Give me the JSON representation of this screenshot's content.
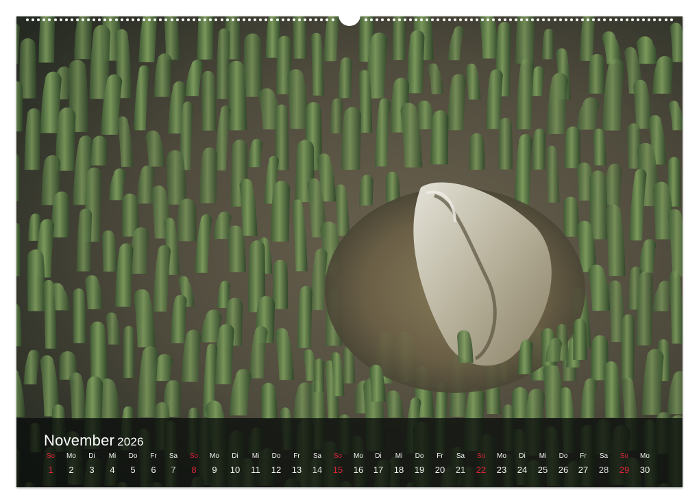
{
  "calendar": {
    "month": "November",
    "year": "2026",
    "days": [
      {
        "wd": "So",
        "d": "1",
        "sun": true
      },
      {
        "wd": "Mo",
        "d": "2"
      },
      {
        "wd": "Di",
        "d": "3"
      },
      {
        "wd": "Mi",
        "d": "4"
      },
      {
        "wd": "Do",
        "d": "5"
      },
      {
        "wd": "Fr",
        "d": "6"
      },
      {
        "wd": "Sa",
        "d": "7",
        "sat": true
      },
      {
        "wd": "So",
        "d": "8",
        "sun": true
      },
      {
        "wd": "Mo",
        "d": "9"
      },
      {
        "wd": "Di",
        "d": "10"
      },
      {
        "wd": "Mi",
        "d": "11"
      },
      {
        "wd": "Do",
        "d": "12"
      },
      {
        "wd": "Fr",
        "d": "13"
      },
      {
        "wd": "Sa",
        "d": "14",
        "sat": true
      },
      {
        "wd": "So",
        "d": "15",
        "sun": true
      },
      {
        "wd": "Mo",
        "d": "16"
      },
      {
        "wd": "Di",
        "d": "17"
      },
      {
        "wd": "Mi",
        "d": "18"
      },
      {
        "wd": "Do",
        "d": "19"
      },
      {
        "wd": "Fr",
        "d": "20"
      },
      {
        "wd": "Sa",
        "d": "21",
        "sat": true
      },
      {
        "wd": "So",
        "d": "22",
        "sun": true
      },
      {
        "wd": "Mo",
        "d": "23"
      },
      {
        "wd": "Di",
        "d": "24"
      },
      {
        "wd": "Mi",
        "d": "25"
      },
      {
        "wd": "Do",
        "d": "26"
      },
      {
        "wd": "Fr",
        "d": "27"
      },
      {
        "wd": "Sa",
        "d": "28",
        "sat": true
      },
      {
        "wd": "So",
        "d": "29",
        "sun": true
      },
      {
        "wd": "Mo",
        "d": "30"
      }
    ]
  },
  "colors": {
    "sunday": "#e0243a",
    "text": "#f2f2f2",
    "band": "#0a0e0c"
  },
  "photo": {
    "subject": "shell-on-anemone-tentacles"
  }
}
